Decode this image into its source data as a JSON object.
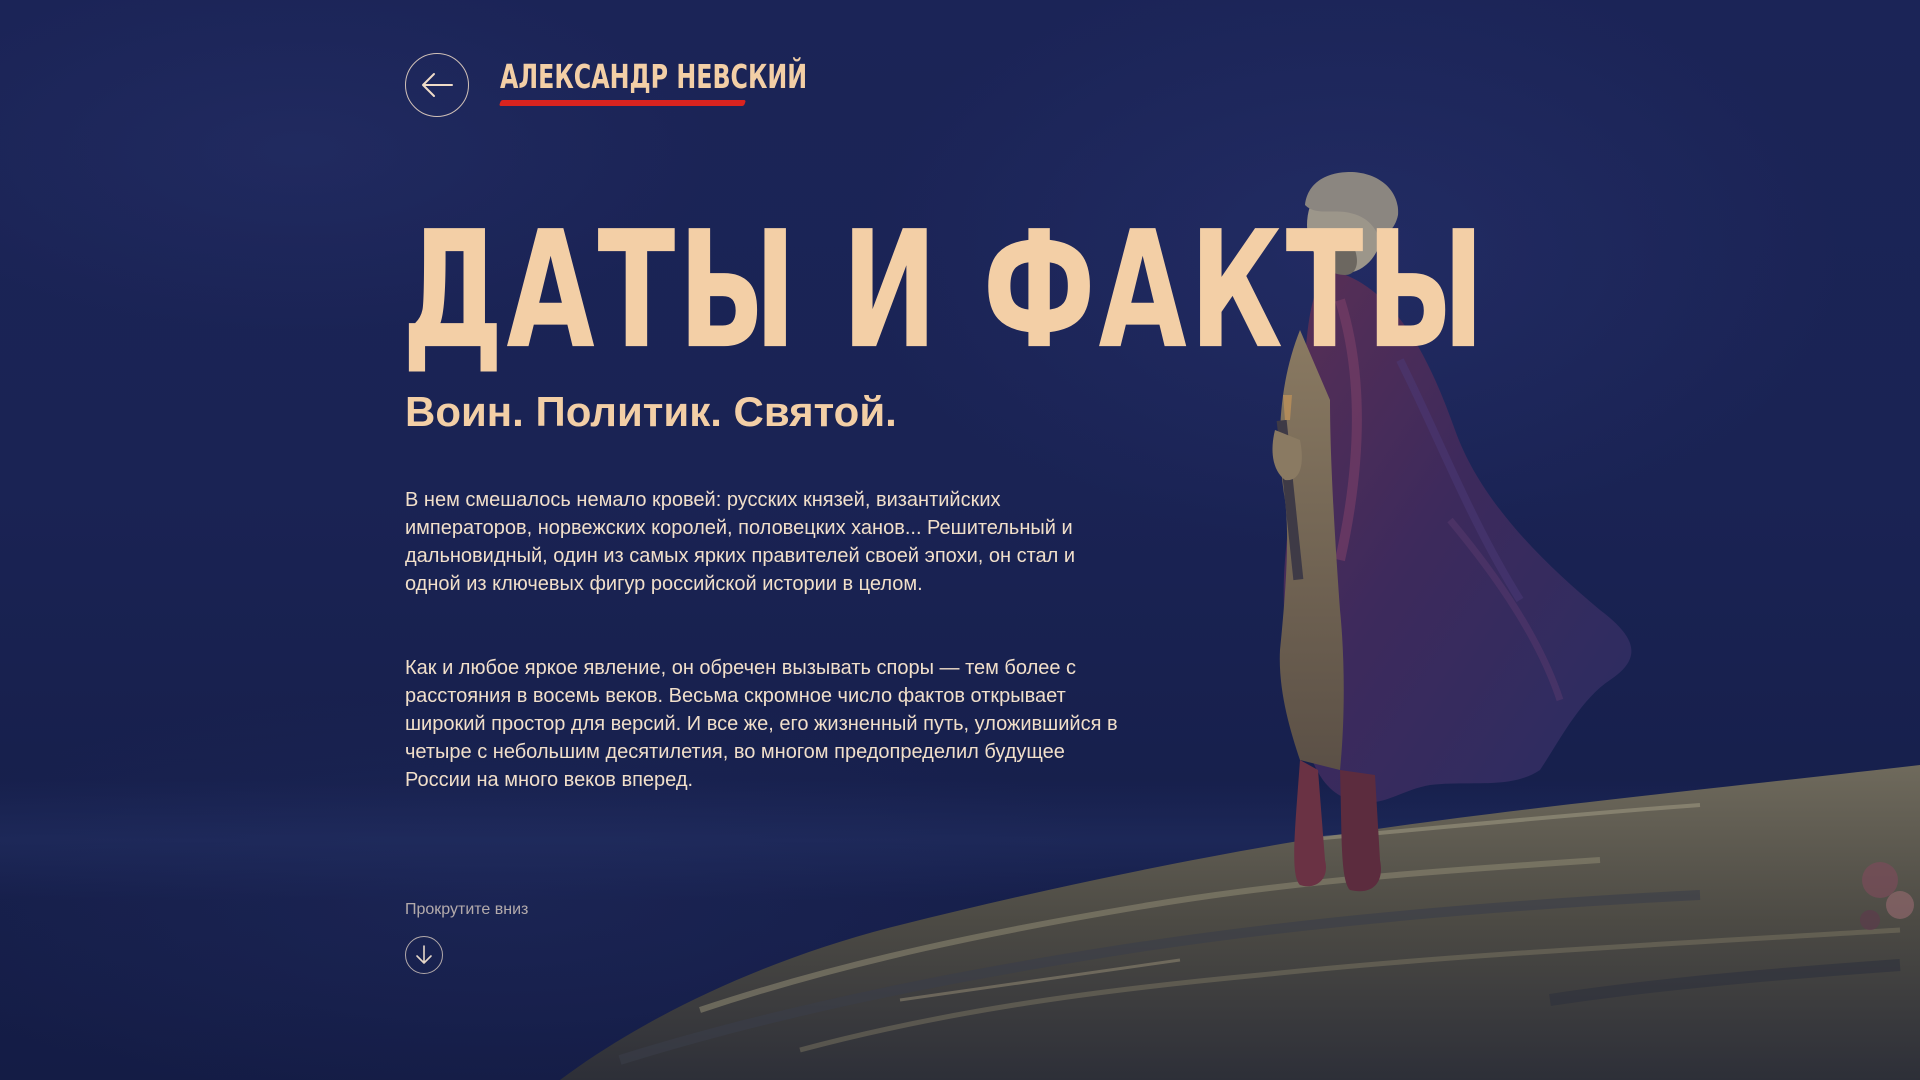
{
  "header": {
    "back_icon": "arrow-left-icon",
    "logo_text": "АЛЕКСАНДР НЕВСКИЙ",
    "logo_underline_color": "#d8231f"
  },
  "hero": {
    "title": "ДАТЫ И ФАКТЫ",
    "subtitle": "Воин. Политик. Святой.",
    "paragraphs": [
      "В нем смешалось немало кровей: русских князей, византийских императоров, норвежских королей, половецких ханов... Решительный и дальновидный, один из самых ярких правителей своей эпохи, он стал и одной из ключевых фигур российской истории в целом.",
      "Как и любое яркое явление, он обречен вызывать споры — тем более с расстояния в восемь веков. Весьма скромное число фактов открывает широкий простор для версий.  И все же, его жизненный путь, уложившийся в четыре с небольшим десятилетия,  во многом предопределил будущее России на много веков вперед."
    ]
  },
  "scroll": {
    "label": "Прокрутите вниз",
    "icon": "arrow-down-icon"
  },
  "colors": {
    "background": "#1a2350",
    "accent_text": "#f3cfa6",
    "body_text": "#f1dfca",
    "logo_underline": "#d8231f"
  }
}
